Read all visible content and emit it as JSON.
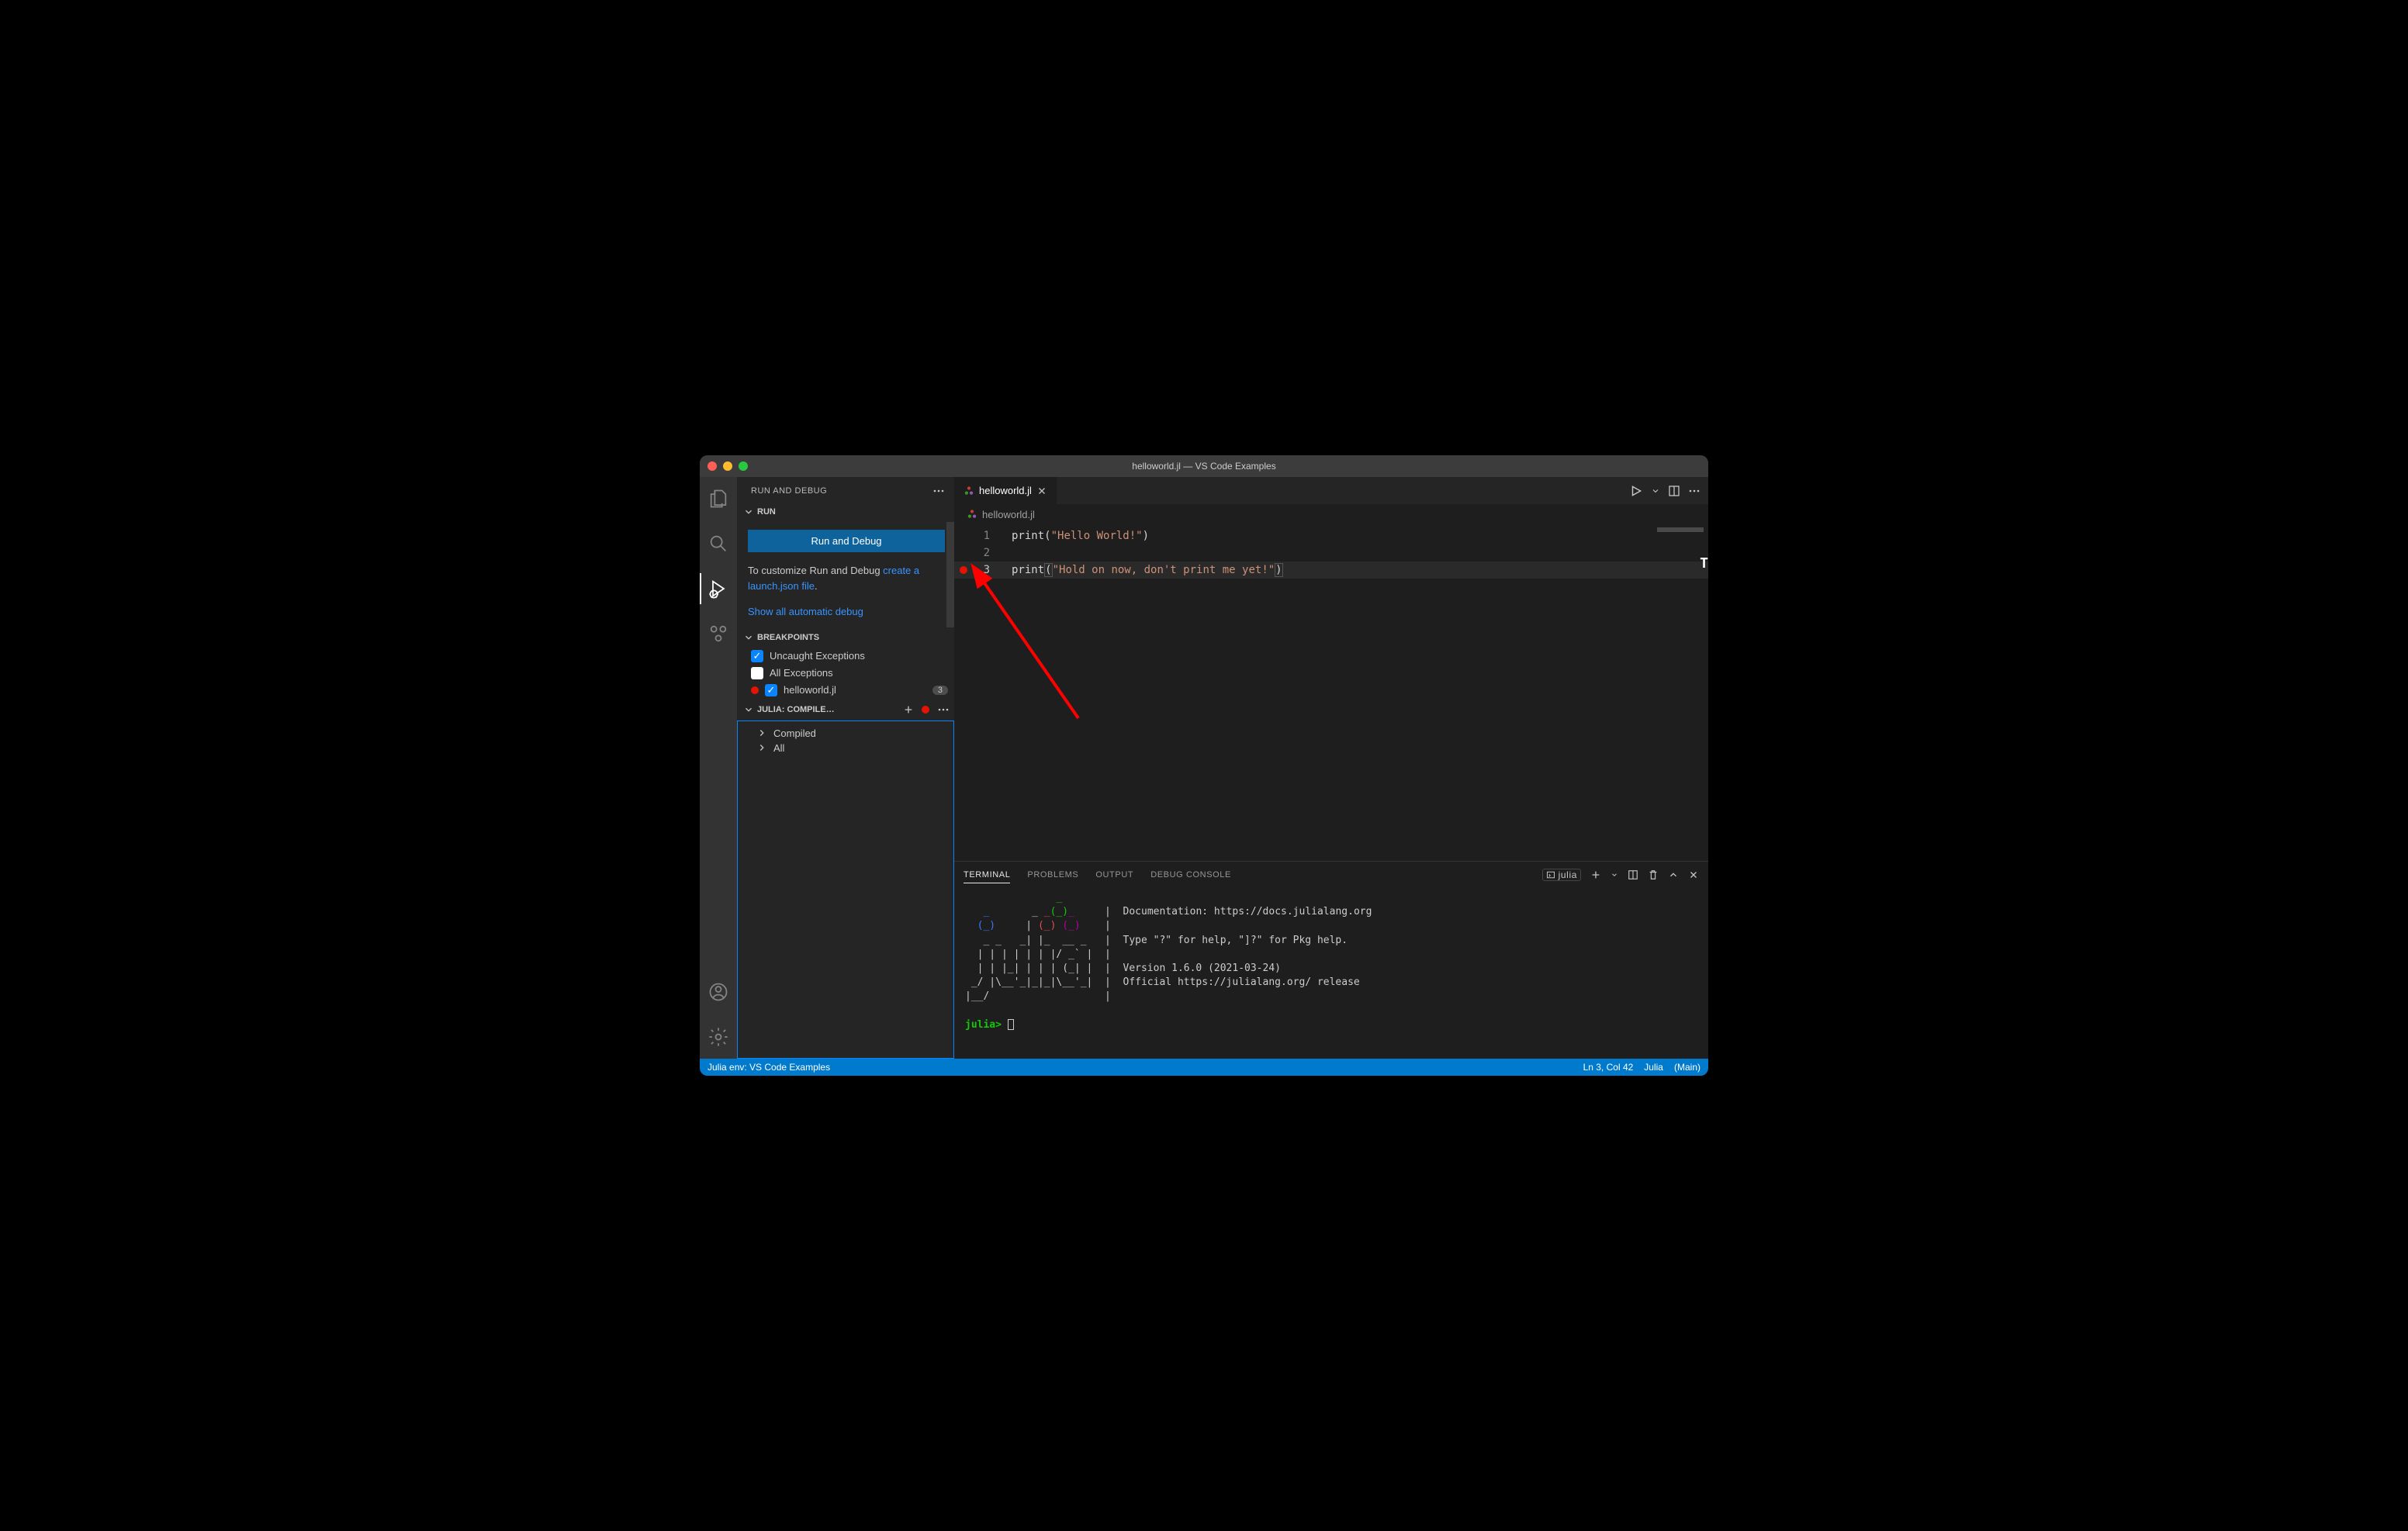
{
  "window": {
    "title": "helloworld.jl — VS Code Examples"
  },
  "sidebar": {
    "title": "RUN AND DEBUG",
    "run_section": {
      "header": "RUN",
      "button": "Run and Debug",
      "text_before": "To customize Run and Debug ",
      "link": "create a launch.json file",
      "text_after": ".",
      "show_auto": "Show all automatic debug"
    },
    "breakpoints": {
      "header": "BREAKPOINTS",
      "items": [
        {
          "label": "Uncaught Exceptions",
          "checked": true,
          "dot": false,
          "count": null
        },
        {
          "label": "All Exceptions",
          "checked": false,
          "dot": false,
          "count": null
        },
        {
          "label": "helloworld.jl",
          "checked": true,
          "dot": true,
          "count": "3"
        }
      ]
    },
    "julia_compiled": {
      "header": "JULIA: COMPILE…",
      "rows": [
        "Compiled",
        "All"
      ]
    }
  },
  "tab": {
    "name": "helloworld.jl"
  },
  "breadcrumb": {
    "file": "helloworld.jl"
  },
  "editor": {
    "lines": [
      {
        "num": "1",
        "bp": false,
        "current": false,
        "fn": "print",
        "str": "\"Hello World!\""
      },
      {
        "num": "2",
        "bp": false,
        "current": false
      },
      {
        "num": "3",
        "bp": true,
        "current": true,
        "fn": "print",
        "str": "\"Hold on now, don't print me yet!\""
      }
    ]
  },
  "panel": {
    "tabs": {
      "terminal": "TERMINAL",
      "problems": "PROBLEMS",
      "output": "OUTPUT",
      "debug": "DEBUG CONSOLE"
    },
    "launcher": "julia"
  },
  "terminal": {
    "info_doc": "Documentation: https://docs.julialang.org",
    "info_help": "Type \"?\" for help, \"]?\" for Pkg help.",
    "info_ver": "Version 1.6.0 (2021-03-24)",
    "info_rel": "Official https://julialang.org/ release",
    "prompt": "julia>"
  },
  "status": {
    "left": "Julia env: VS Code Examples",
    "lncol": "Ln 3, Col 42",
    "lang": "Julia",
    "branch": "(Main)"
  }
}
